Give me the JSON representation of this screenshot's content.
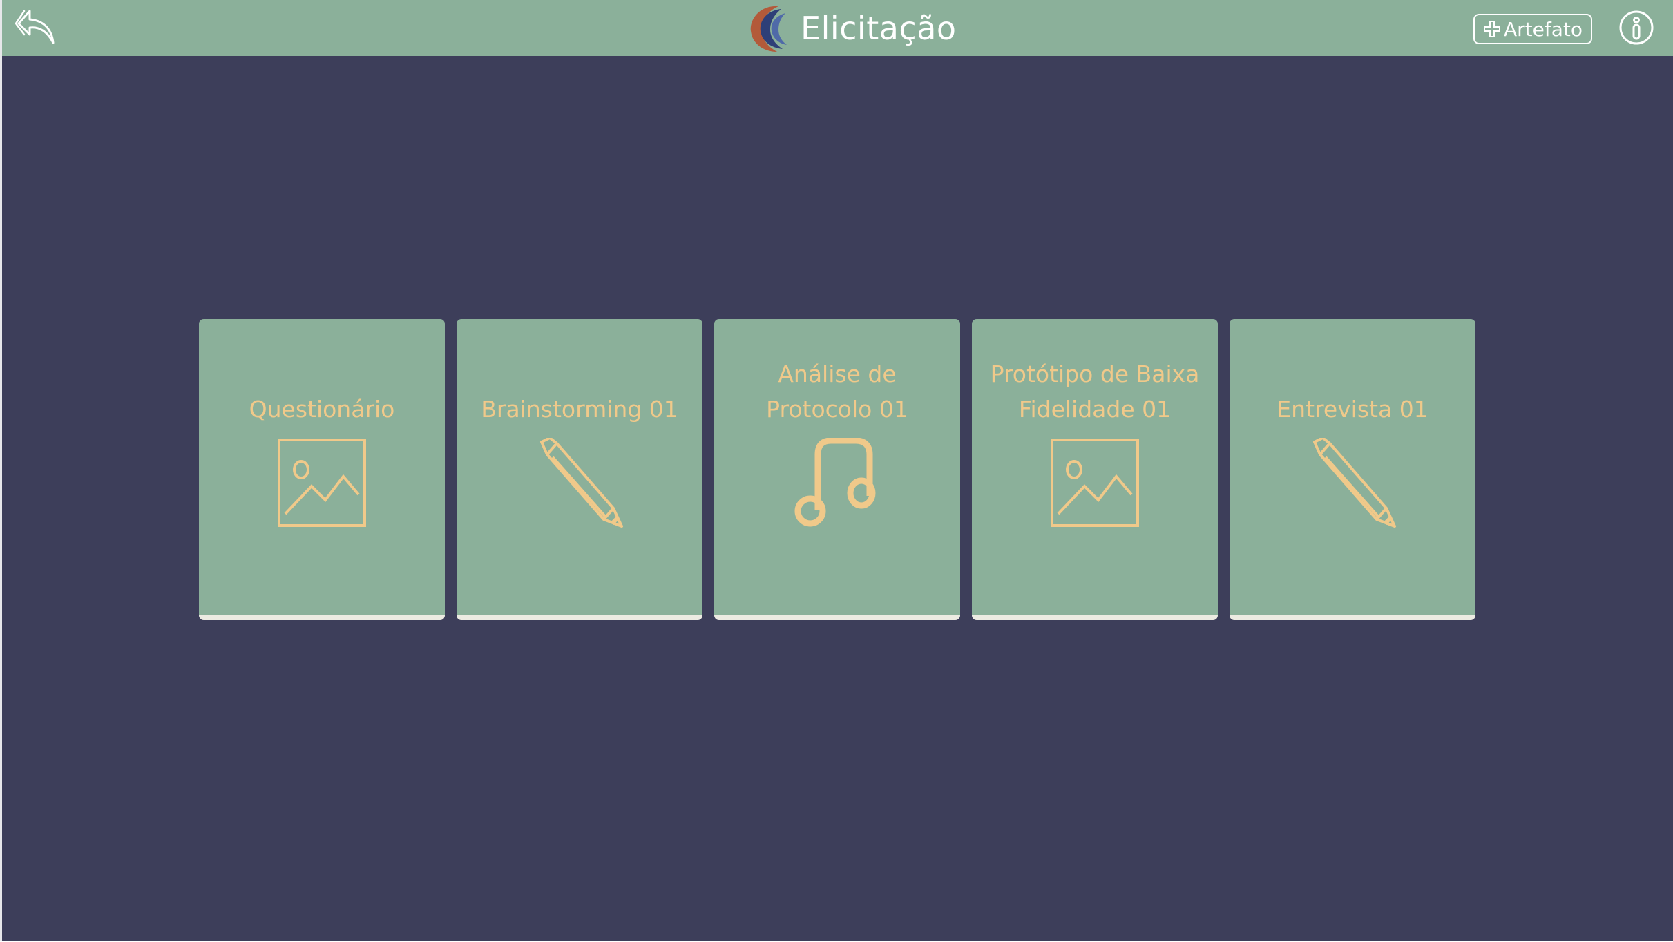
{
  "header": {
    "title": "Elicitação",
    "back_icon": "back-arrow-icon",
    "logo_icon": "app-logo-icon",
    "add_artifact_label": "Artefato",
    "add_icon": "plus-icon",
    "info_icon": "info-icon"
  },
  "colors": {
    "background": "#3d3e5a",
    "header": "#8bb09a",
    "card": "#8bb09a",
    "card_text": "#f0c98a",
    "card_bottom": "#ecebe2"
  },
  "cards": [
    {
      "label": "Questionário",
      "icon": "image-icon"
    },
    {
      "label": "Brainstorming 01",
      "icon": "pencil-icon"
    },
    {
      "label": "Análise de Protocolo 01",
      "icon": "music-note-icon"
    },
    {
      "label": "Protótipo de Baixa Fidelidade 01",
      "icon": "image-icon"
    },
    {
      "label": "Entrevista 01",
      "icon": "pencil-icon"
    }
  ]
}
